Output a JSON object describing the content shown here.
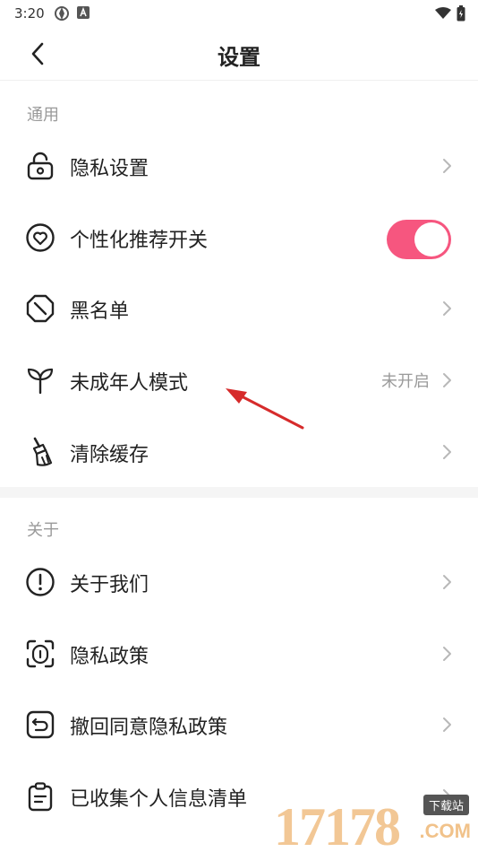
{
  "status_bar": {
    "time": "3:20"
  },
  "header": {
    "title": "设置"
  },
  "sections": [
    {
      "label": "通用",
      "items": [
        {
          "label": "隐私设置",
          "icon": "lock-icon"
        },
        {
          "label": "个性化推荐开关",
          "icon": "heart-icon",
          "toggle_on": true
        },
        {
          "label": "黑名单",
          "icon": "block-icon"
        },
        {
          "label": "未成年人模式",
          "icon": "sprout-icon",
          "value": "未开启"
        },
        {
          "label": "清除缓存",
          "icon": "broom-icon"
        }
      ]
    },
    {
      "label": "关于",
      "items": [
        {
          "label": "关于我们",
          "icon": "info-icon"
        },
        {
          "label": "隐私政策",
          "icon": "privacy-icon"
        },
        {
          "label": "撤回同意隐私政策",
          "icon": "undo-icon"
        },
        {
          "label": "已收集个人信息清单",
          "icon": "clipboard-icon"
        }
      ]
    }
  ],
  "colors": {
    "toggle_on": "#f6567f",
    "annotation_arrow": "#d62b2b"
  },
  "watermark": {
    "number": "17178",
    "tag": "下载站",
    "domain": ".COM"
  }
}
